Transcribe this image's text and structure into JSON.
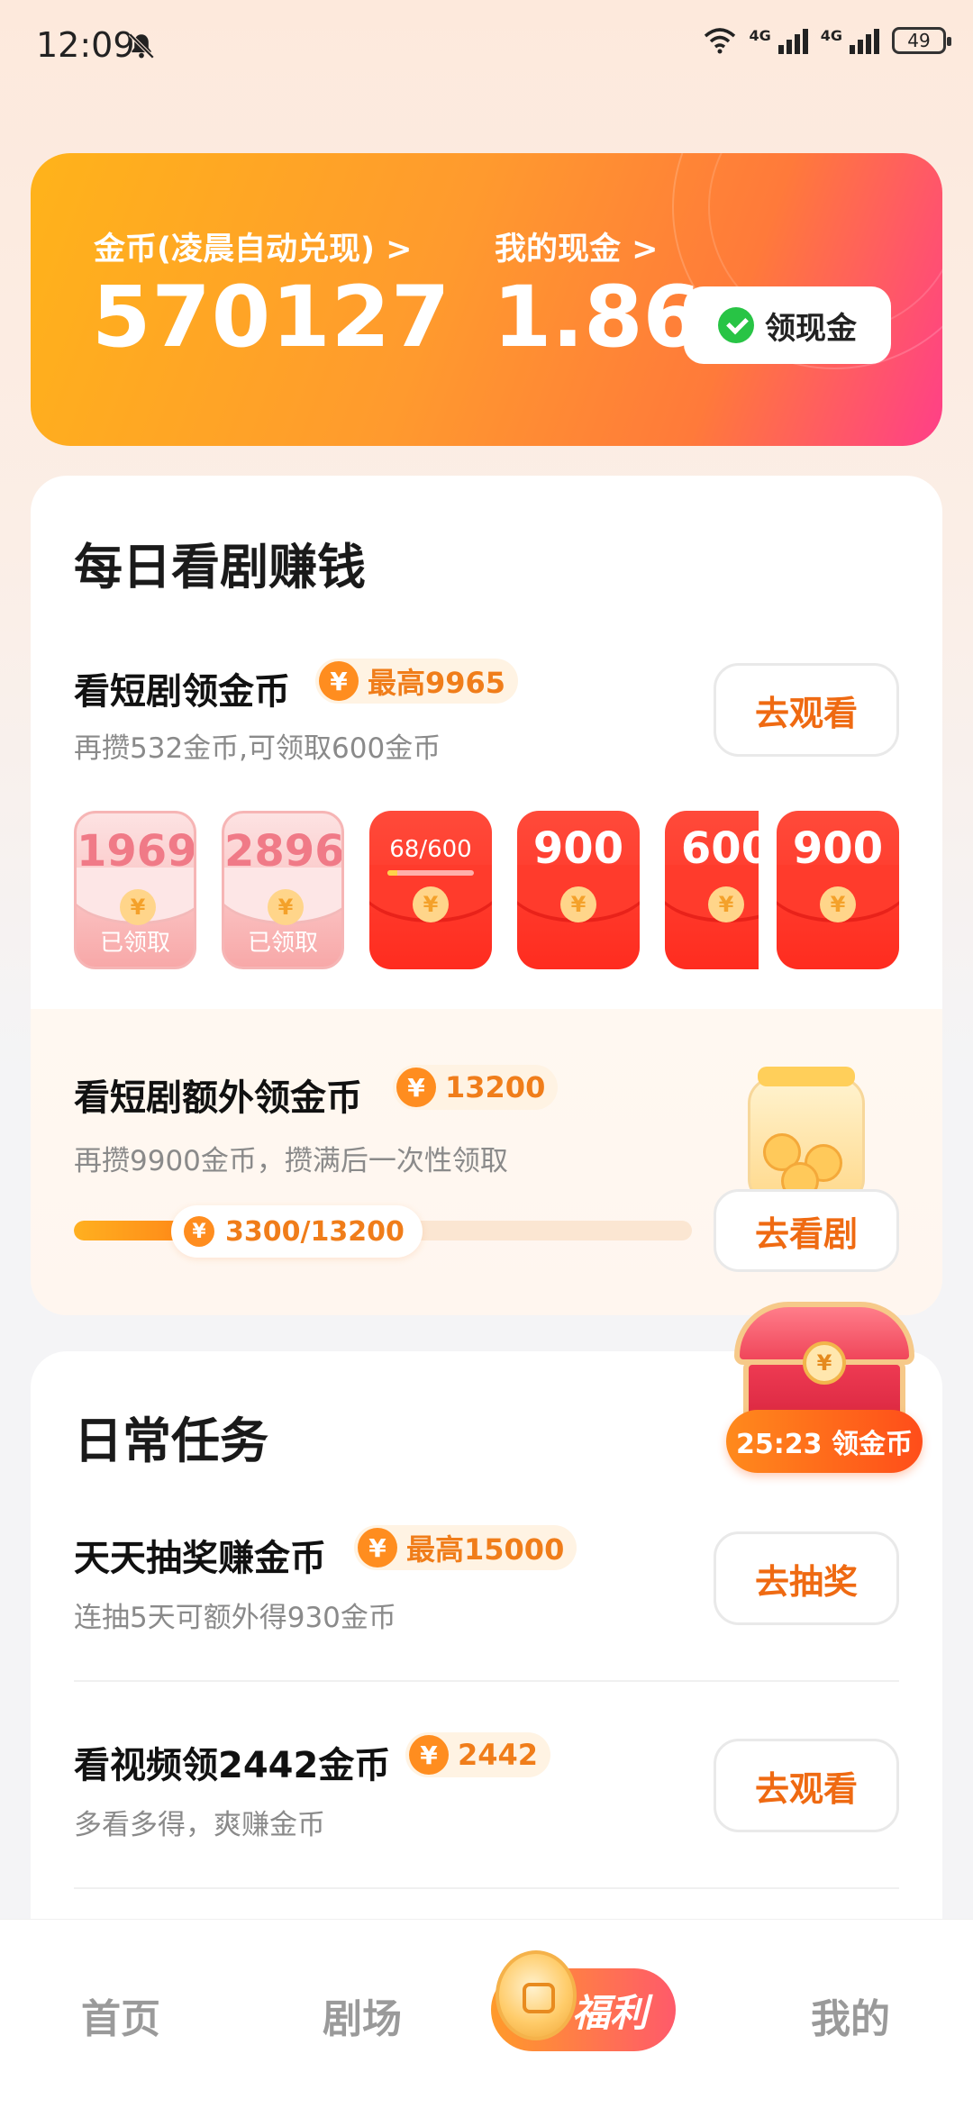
{
  "status_bar": {
    "time": "12:09",
    "network_1": "4G",
    "network_2": "4G",
    "battery": "49"
  },
  "wallet": {
    "coins_label": "金币(凌晨自动兑现) >",
    "coins_value": "570127",
    "cash_label": "我的现金 >",
    "cash_value": "1.86",
    "withdraw_label": "领现金"
  },
  "daily_watch": {
    "title": "每日看剧赚钱",
    "task": {
      "title": "看短剧领金币",
      "badge": "最高9965",
      "subtitle": "再攒532金币,可领取600金币",
      "button": "去观看"
    },
    "packets": [
      {
        "amount": "1969",
        "status": "已领取",
        "claimed": true
      },
      {
        "amount": "2896",
        "status": "已领取",
        "claimed": true
      },
      {
        "amount": "68/600",
        "status": "",
        "claimed": false,
        "progress": 0.11
      },
      {
        "amount": "900",
        "status": "",
        "claimed": false
      },
      {
        "amount": "600",
        "status": "",
        "claimed": false
      },
      {
        "amount": "900",
        "status": "",
        "claimed": false
      }
    ],
    "extra": {
      "title": "看短剧额外领金币",
      "badge": "13200",
      "subtitle": "再攒9900金币，攒满后一次性领取",
      "progress_text": "3300/13200",
      "progress": 0.25,
      "button": "去看剧"
    }
  },
  "daily_tasks": {
    "title": "日常任务",
    "chest_timer": "25:23 领金币",
    "items": [
      {
        "title": "天天抽奖赚金币",
        "badge": "最高15000",
        "subtitle": "连抽5天可额外得930金币",
        "button": "去抽奖"
      },
      {
        "title": "看视频领2442金币",
        "badge": "2442",
        "subtitle": "多看多得，爽赚金币",
        "button": "去观看"
      }
    ]
  },
  "bottom_nav": {
    "home": "首页",
    "theater": "剧场",
    "welfare": "福利",
    "mine": "我的"
  },
  "colors": {
    "accent": "#ef6a12",
    "coin_orange": "#ff8d1f",
    "packet_red": "#ff2c1f"
  },
  "icons": {
    "yen": "¥"
  }
}
